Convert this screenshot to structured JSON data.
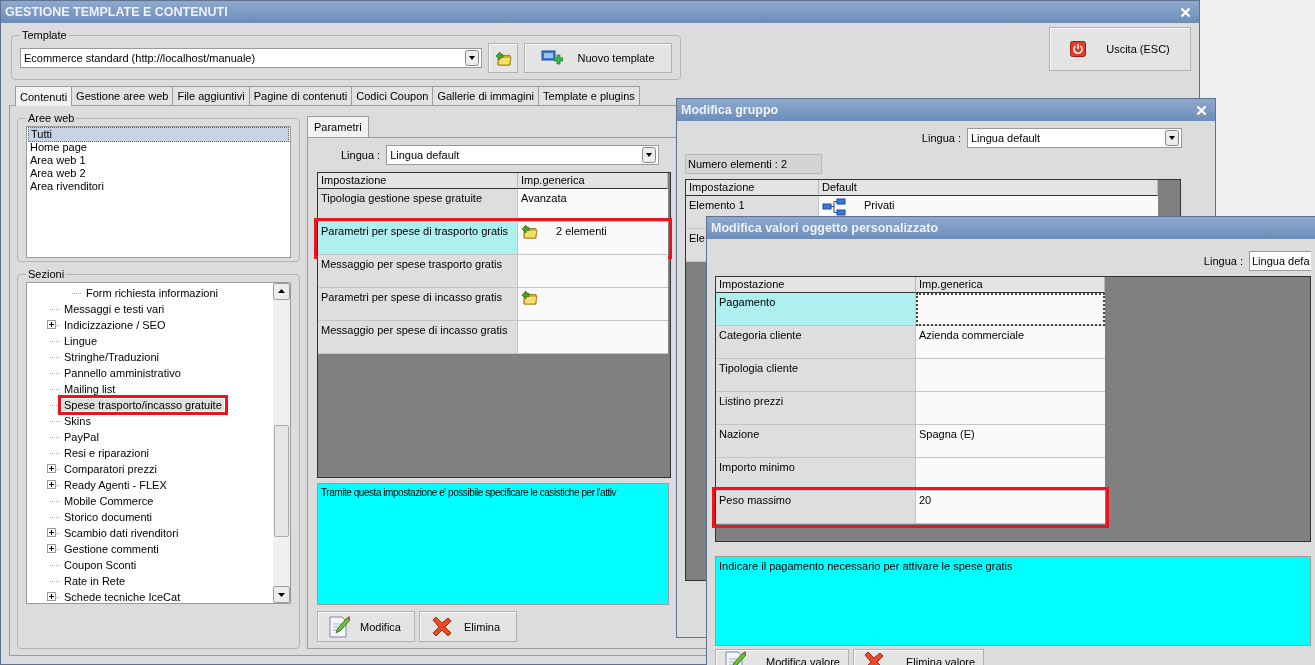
{
  "main_window": {
    "title": "GESTIONE TEMPLATE E CONTENUTI",
    "template": {
      "label": "Template",
      "value": "Ecommerce standard (http://localhost/manuale)",
      "new_button": "Nuovo template"
    },
    "exit_button": "Uscita (ESC)",
    "tabs": [
      {
        "label": "Contenuti",
        "selected": true
      },
      {
        "label": "Gestione aree web",
        "selected": false
      },
      {
        "label": "File aggiuntivi",
        "selected": false
      },
      {
        "label": "Pagine di contenuti",
        "selected": false
      },
      {
        "label": "Codici Coupon",
        "selected": false
      },
      {
        "label": "Gallerie di immagini",
        "selected": false
      },
      {
        "label": "Template e plugins",
        "selected": false
      }
    ],
    "web_areas": {
      "label": "Aree web",
      "items": [
        {
          "label": "Tutti",
          "selected": true
        },
        {
          "label": "Home page",
          "selected": false
        },
        {
          "label": "Area web 1",
          "selected": false
        },
        {
          "label": "Area web 2",
          "selected": false
        },
        {
          "label": "Area rivenditori",
          "selected": false
        }
      ]
    },
    "sections": {
      "label": "Sezioni",
      "items": [
        {
          "children": [
            {
              "label": "Form richiesta informazioni",
              "expandable": false,
              "selected": false,
              "highlighted": false
            }
          ]
        },
        {
          "label": "Messaggi e testi vari",
          "expandable": false,
          "selected": false,
          "highlighted": false
        },
        {
          "label": "Indicizzazione / SEO",
          "expandable": true,
          "selected": false,
          "highlighted": false
        },
        {
          "label": "Lingue",
          "expandable": false,
          "selected": false,
          "highlighted": false
        },
        {
          "label": "Stringhe/Traduzioni",
          "expandable": false,
          "selected": false,
          "highlighted": false
        },
        {
          "label": "Pannello amministrativo",
          "expandable": false,
          "selected": false,
          "highlighted": false
        },
        {
          "label": "Mailing list",
          "expandable": false,
          "selected": false,
          "highlighted": false
        },
        {
          "label": "Spese trasporto/incasso gratuite",
          "expandable": false,
          "selected": true,
          "highlighted": true
        },
        {
          "label": "Skins",
          "expandable": false,
          "selected": false,
          "highlighted": false
        },
        {
          "label": "PayPal",
          "expandable": false,
          "selected": false,
          "highlighted": false
        },
        {
          "label": "Resi e riparazioni",
          "expandable": false,
          "selected": false,
          "highlighted": false
        },
        {
          "label": "Comparatori prezzi",
          "expandable": true,
          "selected": false,
          "highlighted": false
        },
        {
          "label": "Ready Agenti - FLEX",
          "expandable": true,
          "selected": false,
          "highlighted": false
        },
        {
          "label": "Mobile Commerce",
          "expandable": false,
          "selected": false,
          "highlighted": false
        },
        {
          "label": "Storico documenti",
          "expandable": false,
          "selected": false,
          "highlighted": false
        },
        {
          "label": "Scambio dati rivenditori",
          "expandable": true,
          "selected": false,
          "highlighted": false
        },
        {
          "label": "Gestione commenti",
          "expandable": true,
          "selected": false,
          "highlighted": false
        },
        {
          "label": "Coupon Sconti",
          "expandable": false,
          "selected": false,
          "highlighted": false
        },
        {
          "label": "Rate in Rete",
          "expandable": false,
          "selected": false,
          "highlighted": false
        },
        {
          "label": "Schede tecniche IceCat",
          "expandable": true,
          "selected": false,
          "highlighted": false
        }
      ]
    },
    "params": {
      "tab": "Parametri",
      "language_label": "Lingua :",
      "language": "Lingua default",
      "columns": [
        "Impostazione",
        "Imp.generica"
      ],
      "rows": [
        {
          "setting": "Tipologia gestione spese gratuite",
          "kind": "text",
          "value": "Avanzata",
          "selected": false,
          "highlighted": false
        },
        {
          "setting": "Parametri per spese di trasporto gratis",
          "kind": "folder",
          "value": "2 elementi",
          "selected": true,
          "highlighted": true
        },
        {
          "setting": "Messaggio per spese trasporto gratis",
          "kind": "text",
          "selected": false,
          "highlighted": false
        },
        {
          "setting": "Parametri per spese di incasso gratis",
          "kind": "folder",
          "selected": false,
          "highlighted": false
        },
        {
          "setting": "Messaggio per spese di incasso gratis",
          "kind": "text",
          "selected": false,
          "highlighted": false
        }
      ],
      "description": "Tramite questa impostazione e' possibile specificare le casistiche per l'attiv",
      "buttons": [
        {
          "label": "Modifica",
          "kind": "edit"
        },
        {
          "label": "Elimina",
          "kind": "delete"
        }
      ]
    }
  },
  "group_dialog": {
    "title": "Modifica gruppo",
    "language_label": "Lingua :",
    "language": "Lingua default",
    "count": "Numero elementi : 2",
    "columns": [
      "Impostazione",
      "Default"
    ],
    "rows": [
      {
        "setting": "Elemento 1",
        "kind": "tree",
        "value": "Privati",
        "selected": false,
        "highlighted": false
      },
      {
        "setting": "Ele",
        "kind": "text",
        "selected": false,
        "highlighted": false
      }
    ]
  },
  "values_dialog": {
    "title": "Modifica valori oggetto personalizzato",
    "language_label": "Lingua :",
    "language": "Lingua defa",
    "columns": [
      "Impostazione",
      "Imp.generica"
    ],
    "rows": [
      {
        "setting": "Pagamento",
        "kind": "text",
        "selected": true,
        "highlighted": false
      },
      {
        "setting": "Categoria cliente",
        "kind": "text",
        "value": "Azienda commerciale",
        "selected": false,
        "highlighted": false
      },
      {
        "setting": "Tipologia cliente",
        "kind": "text",
        "selected": false,
        "highlighted": false
      },
      {
        "setting": "Listino prezzi",
        "kind": "text",
        "selected": false,
        "highlighted": false
      },
      {
        "setting": "Nazione",
        "kind": "text",
        "value": "Spagna (E)",
        "selected": false,
        "highlighted": false
      },
      {
        "setting": "Importo minimo",
        "kind": "text",
        "selected": false,
        "highlighted": false
      },
      {
        "setting": "Peso massimo",
        "kind": "text",
        "value": "20",
        "selected": false,
        "highlighted": true
      }
    ],
    "description": "Indicare il pagamento necessario per attivare le spese gratis",
    "buttons": [
      {
        "label": "Modifica valore",
        "kind": "edit"
      },
      {
        "label": "Elimina valore",
        "kind": "delete"
      }
    ]
  }
}
